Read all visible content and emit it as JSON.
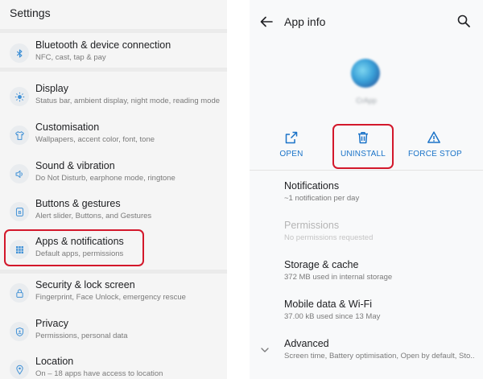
{
  "left": {
    "title": "Settings",
    "items": [
      {
        "title": "Bluetooth & device connection",
        "subtitle": "NFC, cast, tap & pay",
        "icon": "bluetooth-icon"
      },
      {
        "title": "Display",
        "subtitle": "Status bar, ambient display, night mode, reading mode",
        "icon": "brightness-icon"
      },
      {
        "title": "Customisation",
        "subtitle": "Wallpapers, accent color, font, tone",
        "icon": "shirt-icon"
      },
      {
        "title": "Sound & vibration",
        "subtitle": "Do Not Disturb, earphone mode, ringtone",
        "icon": "speaker-icon"
      },
      {
        "title": "Buttons & gestures",
        "subtitle": "Alert slider, Buttons, and Gestures",
        "icon": "button-b-icon"
      },
      {
        "title": "Apps & notifications",
        "subtitle": "Default apps, permissions",
        "icon": "apps-grid-icon"
      },
      {
        "title": "Security & lock screen",
        "subtitle": "Fingerprint, Face Unlock, emergency rescue",
        "icon": "lock-icon"
      },
      {
        "title": "Privacy",
        "subtitle": "Permissions, personal data",
        "icon": "shield-icon"
      },
      {
        "title": "Location",
        "subtitle": "On – 18 apps have access to location",
        "icon": "location-pin-icon"
      }
    ]
  },
  "right": {
    "title": "App info",
    "app_name": "CrApp",
    "actions": {
      "open": "OPEN",
      "uninstall": "UNINSTALL",
      "force_stop": "FORCE STOP"
    },
    "items": [
      {
        "title": "Notifications",
        "subtitle": "~1 notification per day",
        "enabled": true
      },
      {
        "title": "Permissions",
        "subtitle": "No permissions requested",
        "enabled": false
      },
      {
        "title": "Storage & cache",
        "subtitle": "372 MB used in internal storage",
        "enabled": true
      },
      {
        "title": "Mobile data & Wi-Fi",
        "subtitle": "37.00 kB used since 13 May",
        "enabled": true
      },
      {
        "title": "Advanced",
        "subtitle": "Screen time, Battery optimisation, Open by default, Sto..",
        "enabled": true
      }
    ]
  },
  "colors": {
    "accent": "#1a73c8",
    "highlight": "#d3182b",
    "icon_tint": "#3d8fd6"
  }
}
